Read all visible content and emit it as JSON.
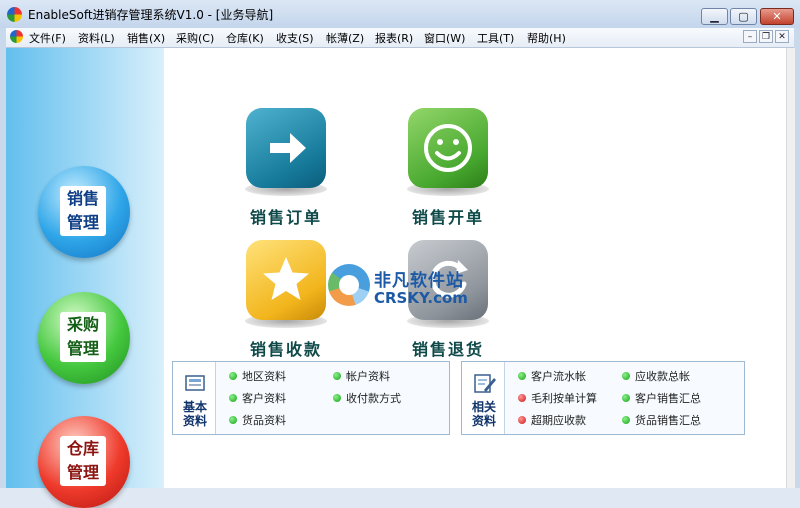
{
  "window": {
    "title": "EnableSoft进销存管理系统V1.0 - [业务导航]",
    "controls": {
      "minimize": "▁",
      "maximize": "▢",
      "close": "✕"
    }
  },
  "menu": {
    "items": [
      "文件(F)",
      "资料(L)",
      "销售(X)",
      "采购(C)",
      "仓库(K)",
      "收支(S)",
      "帐薄(Z)",
      "报表(R)",
      "窗口(W)",
      "工具(T)",
      "帮助(H)"
    ],
    "mdi_controls": {
      "minimize": "–",
      "restore": "❐",
      "close": "✕"
    }
  },
  "sidebar": {
    "buttons": [
      {
        "line1": "销售",
        "line2": "管理",
        "color": "#2fa6e8"
      },
      {
        "line1": "采购",
        "line2": "管理",
        "color": "#45c83f"
      },
      {
        "line1": "仓库",
        "line2": "管理",
        "color": "#ee3a2b"
      }
    ]
  },
  "main": {
    "tiles": [
      {
        "label": "销售订单",
        "icon": "arrow-right-icon",
        "color": "#167a9b"
      },
      {
        "label": "销售开单",
        "icon": "smiley-icon",
        "color": "#47a82e"
      },
      {
        "label": "销售收款",
        "icon": "star-icon",
        "color": "#f2b51c"
      },
      {
        "label": "销售退货",
        "icon": "return-icon",
        "color": "#8f959c"
      }
    ],
    "watermark": {
      "title": "非凡软件站",
      "subtitle": "CRSKY.com"
    },
    "basic_panel": {
      "title_line1": "基本",
      "title_line2": "资料",
      "links": [
        "地区资料",
        "帐户资料",
        "客户资料",
        "收付款方式",
        "货品资料"
      ]
    },
    "related_panel": {
      "title_line1": "相关",
      "title_line2": "资料",
      "links": [
        "客户流水帐",
        "应收款总帐",
        "毛利按单计算",
        "客户销售汇总",
        "超期应收款",
        "货品销售汇总"
      ]
    }
  }
}
